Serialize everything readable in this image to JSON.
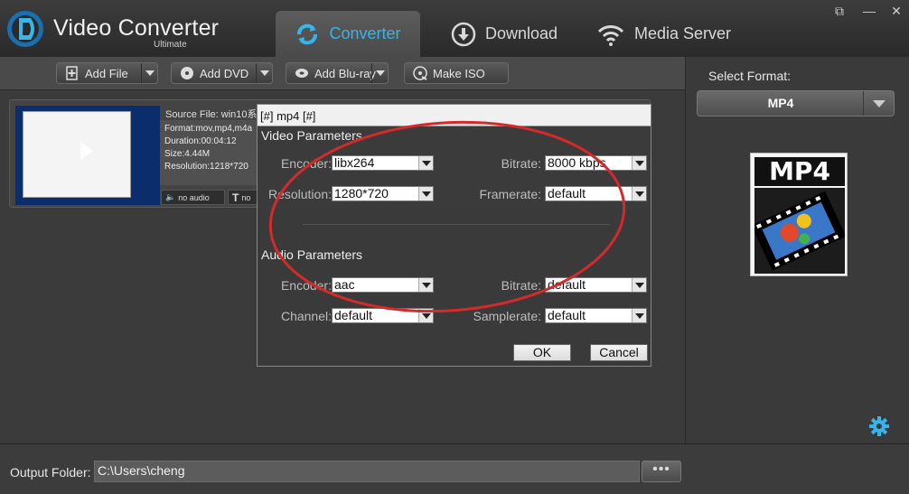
{
  "app": {
    "name": "Video Converter",
    "edition": "Ultimate"
  },
  "tabs": [
    {
      "label": "Converter",
      "active": true
    },
    {
      "label": "Download",
      "active": false
    },
    {
      "label": "Media Server",
      "active": false
    }
  ],
  "window_controls": {
    "popout": "⧉",
    "minimize": "—",
    "close": "✕"
  },
  "toolbar": {
    "add_file": "Add File",
    "add_dvd": "Add DVD",
    "add_bluray": "Add Blu-ray",
    "make_iso": "Make ISO"
  },
  "file_item": {
    "source": "Source File: win10系",
    "format": "Format:mov,mp4,m4a",
    "duration": "Duration:00:04:12",
    "size": "Size:4.44M",
    "resolution": "Resolution:1218*720",
    "audio": "no audio",
    "subtitle": "no"
  },
  "right_panel": {
    "select_label": "Select Format:",
    "format": "MP4",
    "icon_text": "MP4"
  },
  "bottom": {
    "output_label": "Output Folder:",
    "output_path": "C:\\Users\\cheng",
    "browse": "•••"
  },
  "dialog": {
    "title": "[#] mp4 [#]",
    "video_section": "Video Parameters",
    "audio_section": "Audio Parameters",
    "video_encoder_label": "Encoder:",
    "video_encoder": "libx264",
    "video_bitrate_label": "Bitrate:",
    "video_bitrate": "8000 kbps",
    "resolution_label": "Resolution:",
    "resolution": "1280*720",
    "framerate_label": "Framerate:",
    "framerate": "default",
    "audio_encoder_label": "Encoder:",
    "audio_encoder": "aac",
    "audio_bitrate_label": "Bitrate:",
    "audio_bitrate": "default",
    "channel_label": "Channel:",
    "channel": "default",
    "samplerate_label": "Samplerate:",
    "samplerate": "default",
    "ok": "OK",
    "cancel": "Cancel"
  },
  "colors": {
    "accent": "#36b4ec",
    "annotation": "#d42a2a"
  }
}
